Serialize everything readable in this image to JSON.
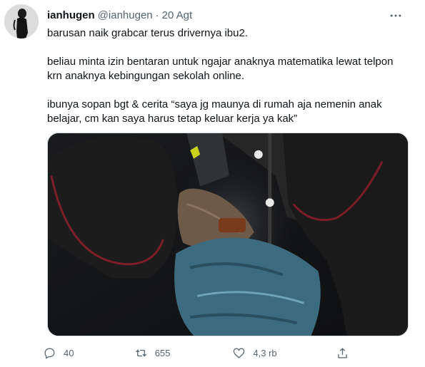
{
  "tweet": {
    "author": {
      "name": "ianhugen",
      "handle": "@ianhugen",
      "separator": "·",
      "date": "20 Agt"
    },
    "paragraphs": [
      "barusan naik grabcar terus drivernya ibu2.",
      "beliau minta izin bentaran untuk ngajar anaknya matematika lewat telpon krn anaknya kebingungan sekolah online.",
      "ibunya sopan bgt & cerita “saya jg maunya di rumah aja nemenin anak belajar, cm kan saya harus tetap keluar kerja ya kak”"
    ],
    "actions": {
      "reply_count": "40",
      "retweet_count": "655",
      "like_count": "4,3 rb"
    },
    "icons": {
      "more": "more-horizontal-icon",
      "reply": "reply-icon",
      "retweet": "retweet-icon",
      "like": "heart-icon",
      "share": "share-icon"
    }
  }
}
